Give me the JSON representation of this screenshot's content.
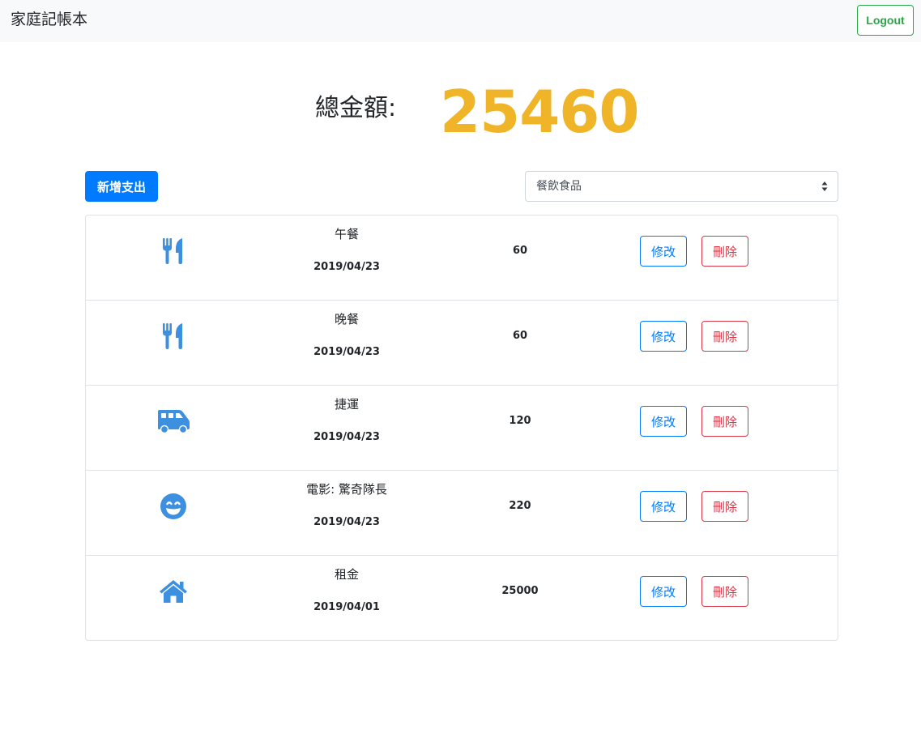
{
  "navbar": {
    "brand": "家庭記帳本",
    "logout_label": "Logout"
  },
  "summary": {
    "total_label": "總金額:",
    "total_value": "25460"
  },
  "toolbar": {
    "add_label": "新增支出",
    "category_selected": "餐飲食品"
  },
  "colors": {
    "primary": "#007bff",
    "danger": "#dc3545",
    "success": "#28a745",
    "total_accent": "#f0b429",
    "icon": "#3d8fe0"
  },
  "records": [
    {
      "icon": "utensils-icon",
      "name": "午餐",
      "date": "2019/04/23",
      "amount": "60",
      "edit_label": "修改",
      "delete_label": "刪除"
    },
    {
      "icon": "utensils-icon",
      "name": "晚餐",
      "date": "2019/04/23",
      "amount": "60",
      "edit_label": "修改",
      "delete_label": "刪除"
    },
    {
      "icon": "shuttle-van-icon",
      "name": "捷運",
      "date": "2019/04/23",
      "amount": "120",
      "edit_label": "修改",
      "delete_label": "刪除"
    },
    {
      "icon": "grin-icon",
      "name": "電影: 驚奇隊長",
      "date": "2019/04/23",
      "amount": "220",
      "edit_label": "修改",
      "delete_label": "刪除"
    },
    {
      "icon": "home-icon",
      "name": "租金",
      "date": "2019/04/01",
      "amount": "25000",
      "edit_label": "修改",
      "delete_label": "刪除"
    }
  ]
}
